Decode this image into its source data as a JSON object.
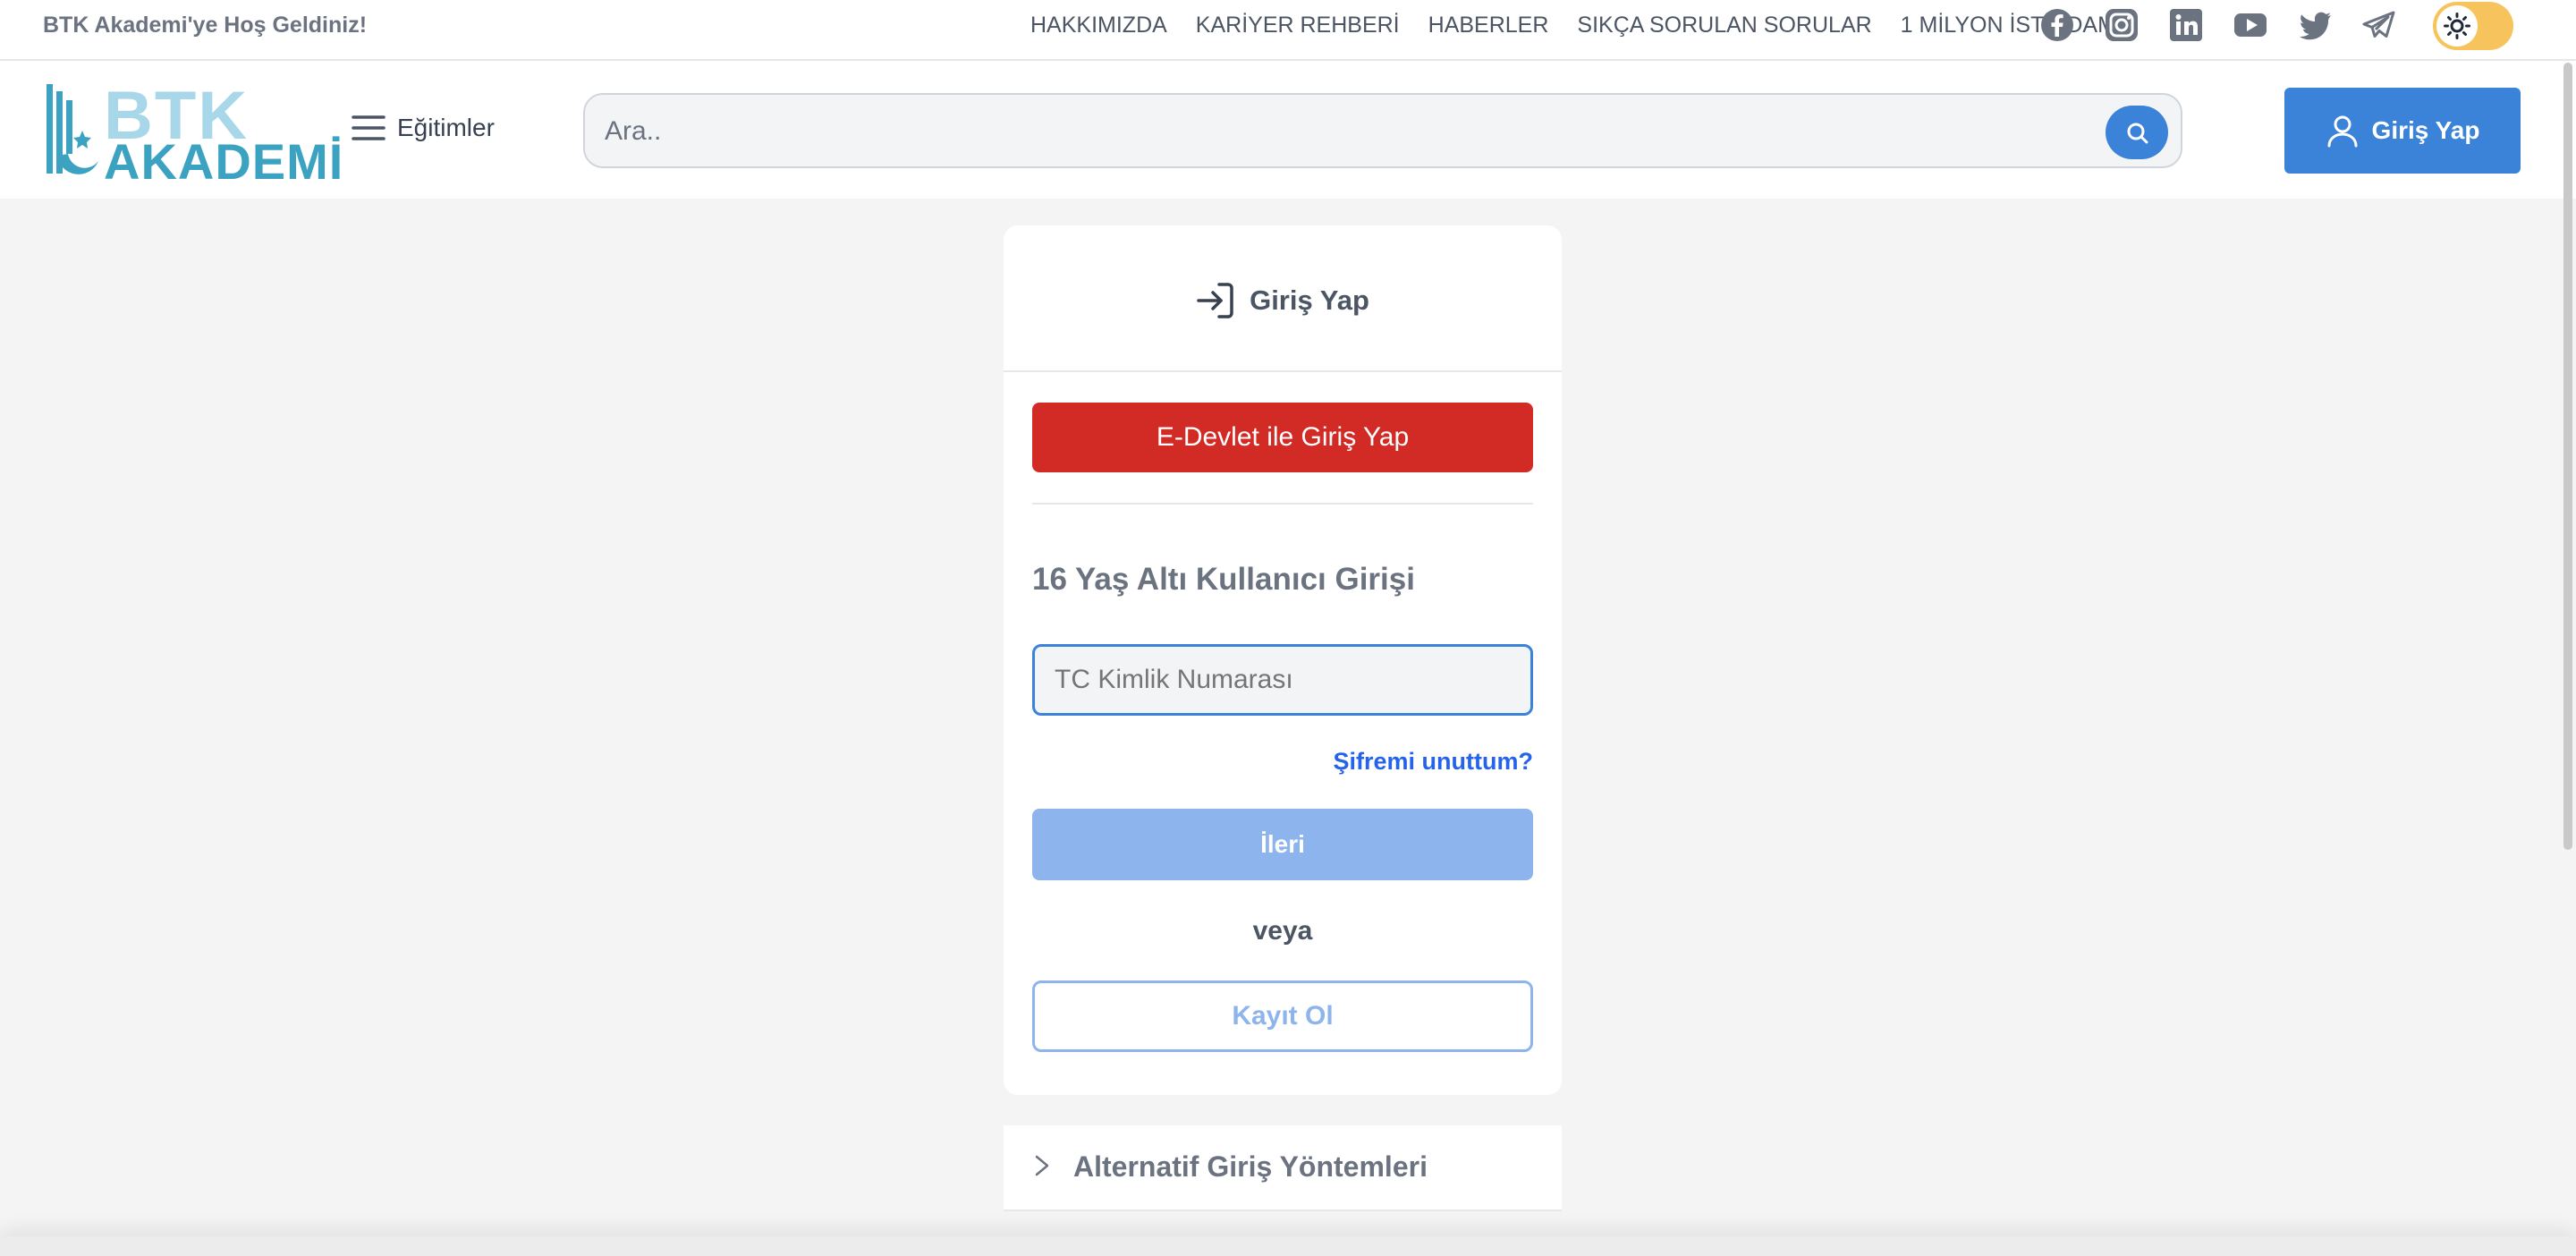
{
  "topbar": {
    "welcome": "BTK Akademi'ye Hoş Geldiniz!",
    "links": [
      "HAKKIMIZDA",
      "KARİYER REHBERİ",
      "HABERLER",
      "SIKÇA SORULAN SORULAR",
      "1 MİLYON İSTİHDAM"
    ],
    "social_icons": [
      "facebook-icon",
      "instagram-icon",
      "linkedin-icon",
      "youtube-icon",
      "twitter-icon",
      "telegram-icon"
    ],
    "theme_toggle_icon": "sun-icon"
  },
  "header": {
    "logo_top": "BTK",
    "logo_bottom": "AKADEMİ",
    "menu_label": "Eğitimler",
    "search_placeholder": "Ara..",
    "login_label": "Giriş Yap"
  },
  "login_card": {
    "title": "Giriş Yap",
    "edevlet_label": "E-Devlet ile Giriş Yap",
    "under16_heading": "16 Yaş Altı Kullanıcı Girişi",
    "tc_placeholder": "TC Kimlik Numarası",
    "forgot_label": "Şifremi unuttum?",
    "next_label": "İleri",
    "or_label": "veya",
    "register_label": "Kayıt Ol"
  },
  "alt_methods": {
    "label": "Alternatif Giriş Yöntemleri"
  },
  "colors": {
    "primary": "#3b82d9",
    "edevlet_red": "#d22b26",
    "disabled_blue": "#8db4ec",
    "toggle_yellow": "#f7c35c"
  }
}
